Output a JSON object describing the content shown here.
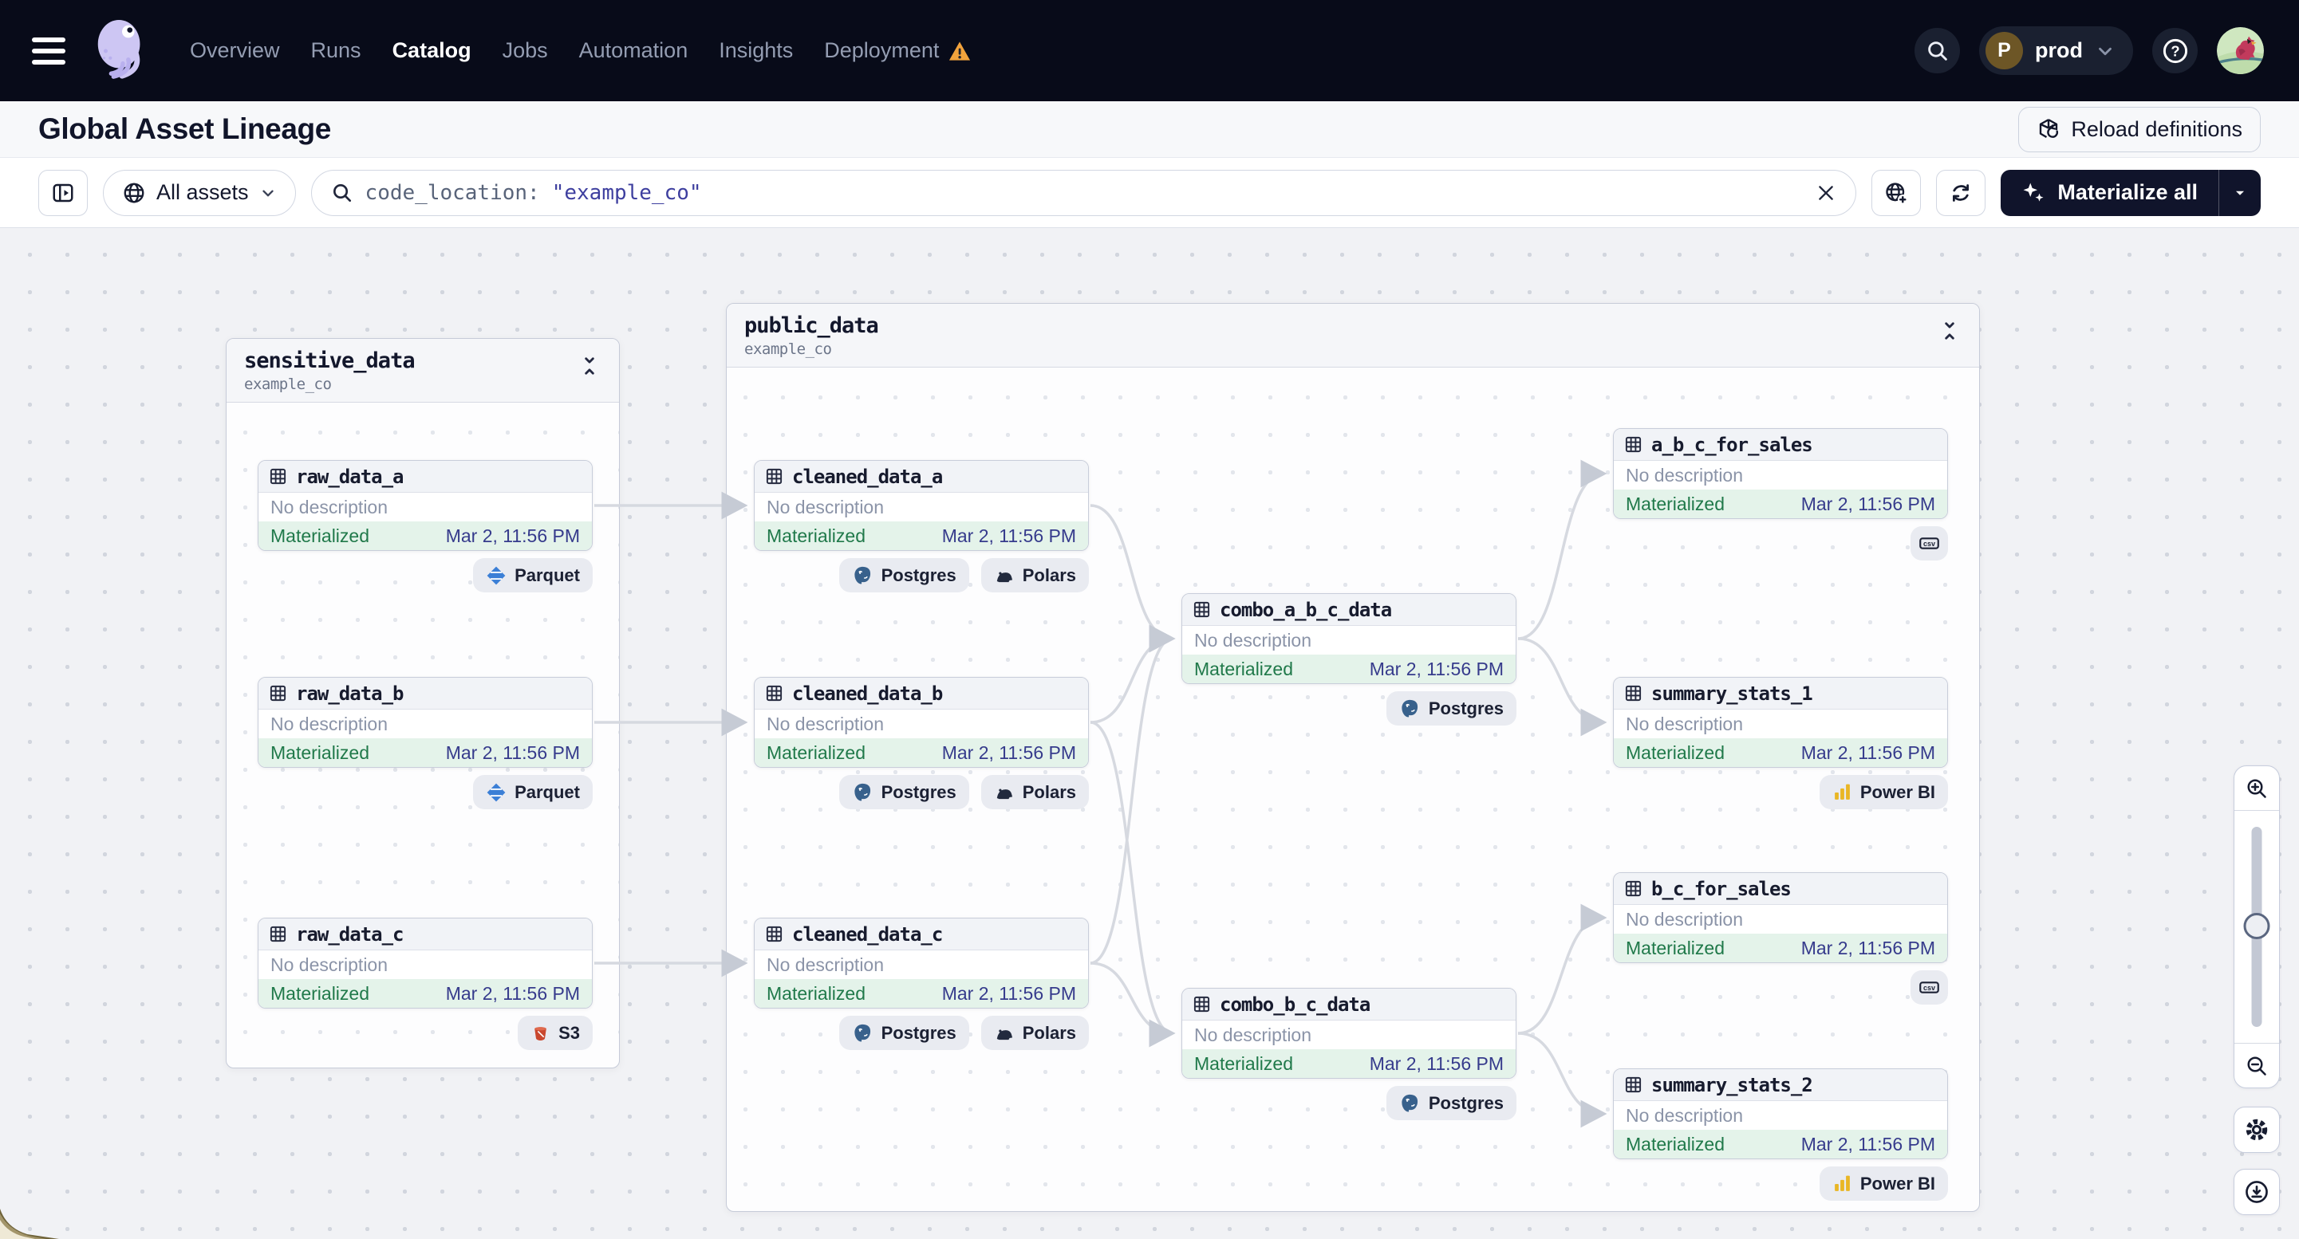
{
  "nav": {
    "items": [
      {
        "label": "Overview",
        "active": false
      },
      {
        "label": "Runs",
        "active": false
      },
      {
        "label": "Catalog",
        "active": true
      },
      {
        "label": "Jobs",
        "active": false
      },
      {
        "label": "Automation",
        "active": false
      },
      {
        "label": "Insights",
        "active": false
      },
      {
        "label": "Deployment",
        "active": false,
        "warning": true
      }
    ],
    "deployment": {
      "initial": "P",
      "name": "prod"
    }
  },
  "page": {
    "title": "Global Asset Lineage",
    "reload_button": "Reload definitions"
  },
  "toolbar": {
    "scope": {
      "label": "All assets"
    },
    "search": {
      "field": "code_location:",
      "value": "\"example_co\""
    },
    "materialize": {
      "label": "Materialize all"
    }
  },
  "graph": {
    "groups": [
      {
        "id": "sensitive_data",
        "name": "sensitive_data",
        "code_location": "example_co"
      },
      {
        "id": "public_data",
        "name": "public_data",
        "code_location": "example_co"
      }
    ],
    "nodes": [
      {
        "id": "raw_data_a",
        "name": "raw_data_a",
        "group": "sensitive_data",
        "description": "No description",
        "status": "Materialized",
        "materialized_at": "Mar 2, 11:56 PM",
        "badges": [
          {
            "icon": "parquet",
            "label": "Parquet"
          }
        ]
      },
      {
        "id": "raw_data_b",
        "name": "raw_data_b",
        "group": "sensitive_data",
        "description": "No description",
        "status": "Materialized",
        "materialized_at": "Mar 2, 11:56 PM",
        "badges": [
          {
            "icon": "parquet",
            "label": "Parquet"
          }
        ]
      },
      {
        "id": "raw_data_c",
        "name": "raw_data_c",
        "group": "sensitive_data",
        "description": "No description",
        "status": "Materialized",
        "materialized_at": "Mar 2, 11:56 PM",
        "badges": [
          {
            "icon": "s3",
            "label": "S3"
          }
        ]
      },
      {
        "id": "cleaned_data_a",
        "name": "cleaned_data_a",
        "group": "public_data",
        "description": "No description",
        "status": "Materialized",
        "materialized_at": "Mar 2, 11:56 PM",
        "badges": [
          {
            "icon": "postgres",
            "label": "Postgres"
          },
          {
            "icon": "polars",
            "label": "Polars"
          }
        ]
      },
      {
        "id": "cleaned_data_b",
        "name": "cleaned_data_b",
        "group": "public_data",
        "description": "No description",
        "status": "Materialized",
        "materialized_at": "Mar 2, 11:56 PM",
        "badges": [
          {
            "icon": "postgres",
            "label": "Postgres"
          },
          {
            "icon": "polars",
            "label": "Polars"
          }
        ]
      },
      {
        "id": "cleaned_data_c",
        "name": "cleaned_data_c",
        "group": "public_data",
        "description": "No description",
        "status": "Materialized",
        "materialized_at": "Mar 2, 11:56 PM",
        "badges": [
          {
            "icon": "postgres",
            "label": "Postgres"
          },
          {
            "icon": "polars",
            "label": "Polars"
          }
        ]
      },
      {
        "id": "combo_a_b_c_data",
        "name": "combo_a_b_c_data",
        "group": "public_data",
        "description": "No description",
        "status": "Materialized",
        "materialized_at": "Mar 2, 11:56 PM",
        "badges": [
          {
            "icon": "postgres",
            "label": "Postgres"
          }
        ]
      },
      {
        "id": "combo_b_c_data",
        "name": "combo_b_c_data",
        "group": "public_data",
        "description": "No description",
        "status": "Materialized",
        "materialized_at": "Mar 2, 11:56 PM",
        "badges": [
          {
            "icon": "postgres",
            "label": "Postgres"
          }
        ]
      },
      {
        "id": "a_b_c_for_sales",
        "name": "a_b_c_for_sales",
        "group": "public_data",
        "description": "No description",
        "status": "Materialized",
        "materialized_at": "Mar 2, 11:56 PM",
        "badges": [
          {
            "icon": "csv",
            "label": ""
          }
        ]
      },
      {
        "id": "summary_stats_1",
        "name": "summary_stats_1",
        "group": "public_data",
        "description": "No description",
        "status": "Materialized",
        "materialized_at": "Mar 2, 11:56 PM",
        "badges": [
          {
            "icon": "powerbi",
            "label": "Power BI"
          }
        ]
      },
      {
        "id": "b_c_for_sales",
        "name": "b_c_for_sales",
        "group": "public_data",
        "description": "No description",
        "status": "Materialized",
        "materialized_at": "Mar 2, 11:56 PM",
        "badges": [
          {
            "icon": "csv",
            "label": ""
          }
        ]
      },
      {
        "id": "summary_stats_2",
        "name": "summary_stats_2",
        "group": "public_data",
        "description": "No description",
        "status": "Materialized",
        "materialized_at": "Mar 2, 11:56 PM",
        "badges": [
          {
            "icon": "powerbi",
            "label": "Power BI"
          }
        ]
      }
    ],
    "edges": [
      [
        "raw_data_a",
        "cleaned_data_a"
      ],
      [
        "raw_data_b",
        "cleaned_data_b"
      ],
      [
        "raw_data_c",
        "cleaned_data_c"
      ],
      [
        "cleaned_data_a",
        "combo_a_b_c_data"
      ],
      [
        "cleaned_data_b",
        "combo_a_b_c_data"
      ],
      [
        "cleaned_data_c",
        "combo_a_b_c_data"
      ],
      [
        "cleaned_data_b",
        "combo_b_c_data"
      ],
      [
        "cleaned_data_c",
        "combo_b_c_data"
      ],
      [
        "combo_a_b_c_data",
        "a_b_c_for_sales"
      ],
      [
        "combo_a_b_c_data",
        "summary_stats_1"
      ],
      [
        "combo_b_c_data",
        "b_c_for_sales"
      ],
      [
        "combo_b_c_data",
        "summary_stats_2"
      ]
    ]
  }
}
